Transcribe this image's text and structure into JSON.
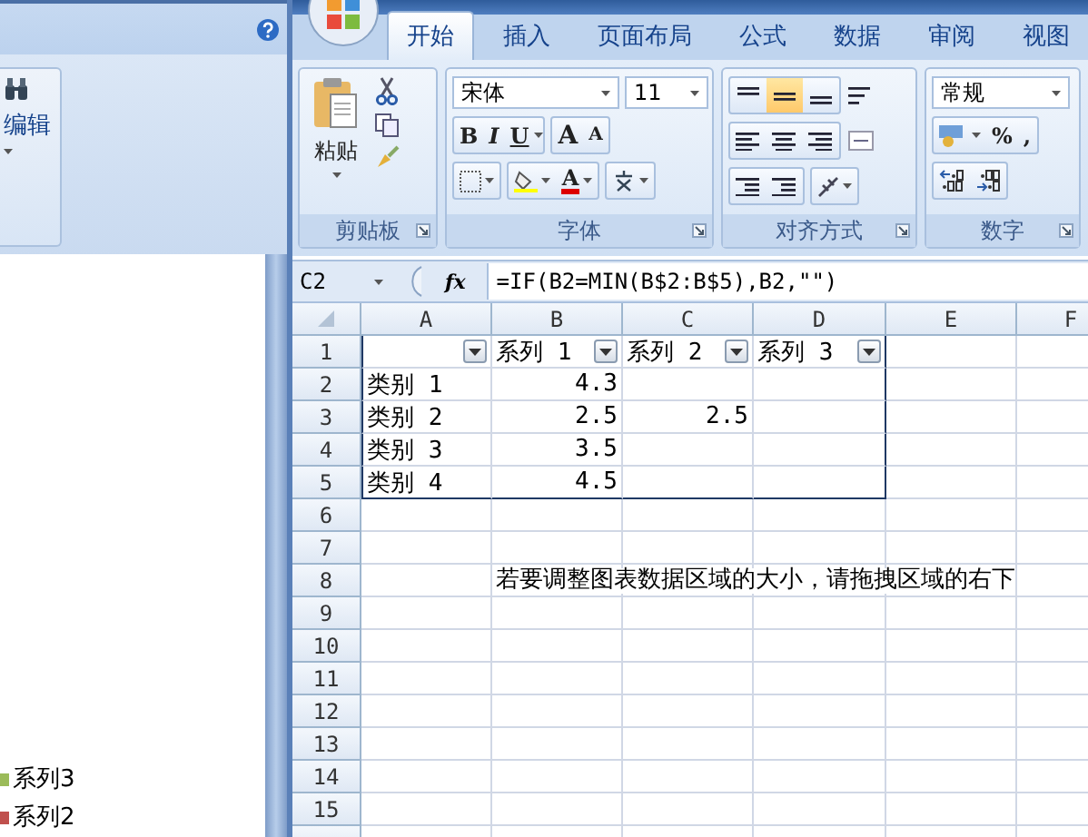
{
  "background_window": {
    "ribbon_group": {
      "label": "编辑"
    },
    "legend": [
      {
        "label": "系列3",
        "color": "#9bbb59"
      },
      {
        "label": "系列2",
        "color": "#c0504d"
      }
    ]
  },
  "tabs": [
    {
      "label": "开始",
      "selected": true
    },
    {
      "label": "插入",
      "selected": false
    },
    {
      "label": "页面布局",
      "selected": false
    },
    {
      "label": "公式",
      "selected": false
    },
    {
      "label": "数据",
      "selected": false
    },
    {
      "label": "审阅",
      "selected": false
    },
    {
      "label": "视图",
      "selected": false
    }
  ],
  "ribbon": {
    "clipboard": {
      "paste_label": "粘贴",
      "group_label": "剪贴板"
    },
    "font": {
      "font_name": "宋体",
      "font_size": "11",
      "style_buttons": [
        "B",
        "I",
        "U"
      ],
      "size_buttons": [
        "A",
        "A"
      ],
      "font_color_button": "A",
      "group_label": "字体"
    },
    "alignment": {
      "vertical": [
        {
          "selected": false
        },
        {
          "selected": true
        },
        {
          "selected": false
        }
      ],
      "group_label": "对齐方式"
    },
    "number": {
      "format": "常规",
      "percent_button": "%",
      "comma_button": ",",
      "group_label": "数字"
    }
  },
  "formula_bar": {
    "cell_ref": "C2",
    "fx": "fx",
    "formula": "=IF(B2=MIN(B$2:B$5),B2,\"\")"
  },
  "columns": [
    {
      "label": "A",
      "in_table": true
    },
    {
      "label": "B",
      "in_table": true
    },
    {
      "label": "C",
      "in_table": true
    },
    {
      "label": "D",
      "in_table": true
    },
    {
      "label": "E",
      "in_table": false
    },
    {
      "label": "F",
      "in_table": false
    }
  ],
  "rows": [
    {
      "number": "1",
      "in_table": true,
      "cells": {
        "A": {
          "kind": "header"
        },
        "B": {
          "kind": "header",
          "text": "系列 1"
        },
        "C": {
          "kind": "header",
          "text": "系列 2"
        },
        "D": {
          "kind": "header",
          "text": "系列 3"
        }
      }
    },
    {
      "number": "2",
      "in_table": true,
      "cells": {
        "A": {
          "kind": "text",
          "text": "类别 1"
        },
        "B": {
          "kind": "number",
          "text": "4.3"
        }
      }
    },
    {
      "number": "3",
      "in_table": true,
      "cells": {
        "A": {
          "kind": "text",
          "text": "类别 2"
        },
        "B": {
          "kind": "number",
          "text": "2.5"
        },
        "C": {
          "kind": "number",
          "text": "2.5"
        }
      }
    },
    {
      "number": "4",
      "in_table": true,
      "cells": {
        "A": {
          "kind": "text",
          "text": "类别 3"
        },
        "B": {
          "kind": "number",
          "text": "3.5"
        }
      }
    },
    {
      "number": "5",
      "in_table": true,
      "cells": {
        "A": {
          "kind": "text",
          "text": "类别 4"
        },
        "B": {
          "kind": "number",
          "text": "4.5"
        }
      }
    },
    {
      "number": "6",
      "in_table": false
    },
    {
      "number": "7",
      "in_table": false
    },
    {
      "number": "8",
      "in_table": false,
      "cells": {
        "B": {
          "kind": "text",
          "text": "若要调整图表数据区域的大小，请拖拽区域的右下"
        }
      }
    },
    {
      "number": "9",
      "in_table": false
    },
    {
      "number": "10",
      "in_table": false
    },
    {
      "number": "11",
      "in_table": false
    },
    {
      "number": "12",
      "in_table": false
    },
    {
      "number": "13",
      "in_table": false
    },
    {
      "number": "14",
      "in_table": false
    },
    {
      "number": "15",
      "in_table": false
    }
  ]
}
